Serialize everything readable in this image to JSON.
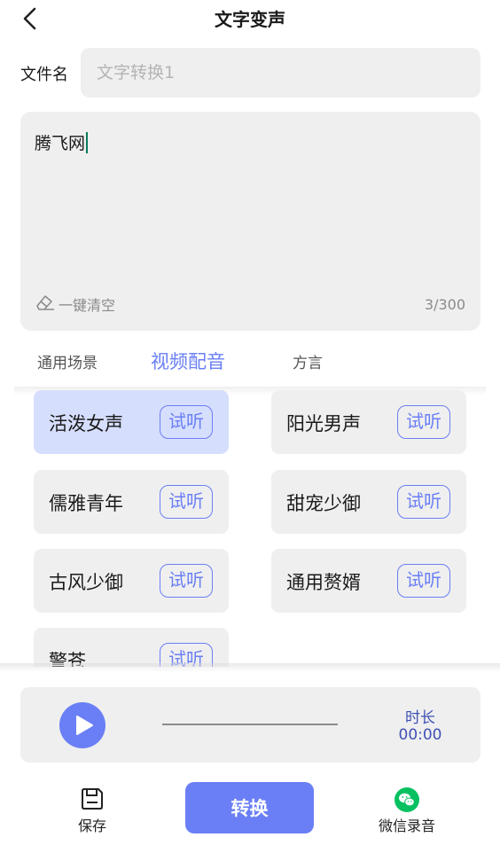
{
  "header": {
    "title": "文字变声",
    "back_icon": "chevron-left-icon"
  },
  "file": {
    "label": "文件名",
    "placeholder": "文字转换1",
    "value": ""
  },
  "editor": {
    "text": "腾飞网",
    "clear_label": "一键清空",
    "clear_icon": "eraser-icon",
    "char_count": "3/300"
  },
  "tabs": [
    {
      "label": "通用场景",
      "active": false
    },
    {
      "label": "视频配音",
      "active": true
    },
    {
      "label": "方言",
      "active": false
    }
  ],
  "voices": [
    {
      "name": "活泼女声",
      "listen": "试听",
      "selected": true
    },
    {
      "name": "阳光男声",
      "listen": "试听",
      "selected": false
    },
    {
      "name": "儒雅青年",
      "listen": "试听",
      "selected": false
    },
    {
      "name": "甜宠少御",
      "listen": "试听",
      "selected": false
    },
    {
      "name": "古风少御",
      "listen": "试听",
      "selected": false
    },
    {
      "name": "通用赘婿",
      "listen": "试听",
      "selected": false
    },
    {
      "name": "警苍",
      "listen": "试听",
      "selected": false
    }
  ],
  "player": {
    "play_icon": "play-icon",
    "duration_label": "时长",
    "duration_value": "00:00",
    "progress": 0
  },
  "actions": {
    "save_label": "保存",
    "save_icon": "floppy-disk-icon",
    "convert_label": "转换",
    "wechat_label": "微信录音",
    "wechat_icon": "wechat-icon"
  },
  "colors": {
    "accent": "#6a7ff5",
    "selected_card": "#d6defd",
    "card_bg": "#efefef",
    "wechat_green": "#07c160",
    "duration_text": "#3f51b5"
  }
}
